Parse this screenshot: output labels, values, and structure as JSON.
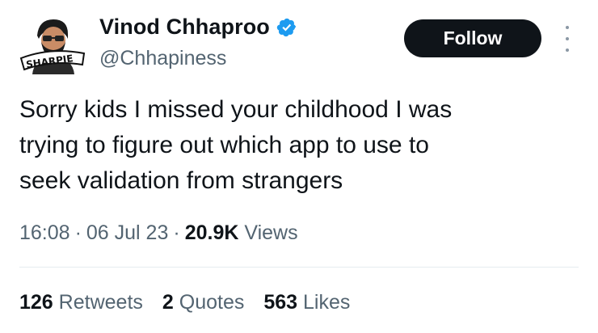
{
  "author": {
    "display_name": "Vinod Chhaproo",
    "handle": "@Chhapiness",
    "verified": true,
    "avatar_icon": "person-with-sharpie-logo-avatar",
    "avatar_text": "SHARPIE"
  },
  "actions": {
    "follow_label": "Follow",
    "more_icon": "vertical-dots-icon"
  },
  "tweet": {
    "text": "Sorry kids I missed your childhood I was\ntrying to figure out which app to use to\nseek validation from strangers",
    "time": "16:08",
    "date": "06 Jul 23",
    "views_count": "20.9K",
    "views_label": "Views"
  },
  "stats": {
    "retweets_count": "126",
    "retweets_label": "Retweets",
    "quotes_count": "2",
    "quotes_label": "Quotes",
    "likes_count": "563",
    "likes_label": "Likes"
  },
  "colors": {
    "text_primary": "#0f1419",
    "text_secondary": "#536471",
    "verified_blue": "#1d9bf0",
    "button_bg": "#0f1419",
    "divider": "#e6ecf0"
  }
}
